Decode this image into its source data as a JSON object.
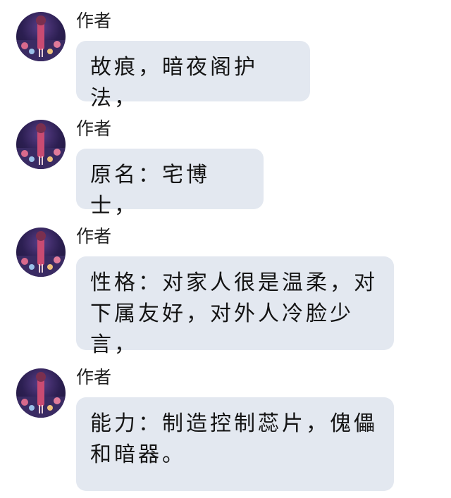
{
  "messages": [
    {
      "sender": "作者",
      "text": "故痕，暗夜阁护法，"
    },
    {
      "sender": "作者",
      "text": "原名：宅博士，"
    },
    {
      "sender": "作者",
      "text": "性格：对家人很是温柔，对下属友好，对外人冷脸少言，"
    },
    {
      "sender": "作者",
      "text": "能力：制造控制蕊片，傀儡和暗器。"
    }
  ],
  "avatar_icon": "anime-girl-avatar-icon",
  "colors": {
    "bubble": "#e3e8f0",
    "text": "#141414",
    "background": "#ffffff"
  }
}
